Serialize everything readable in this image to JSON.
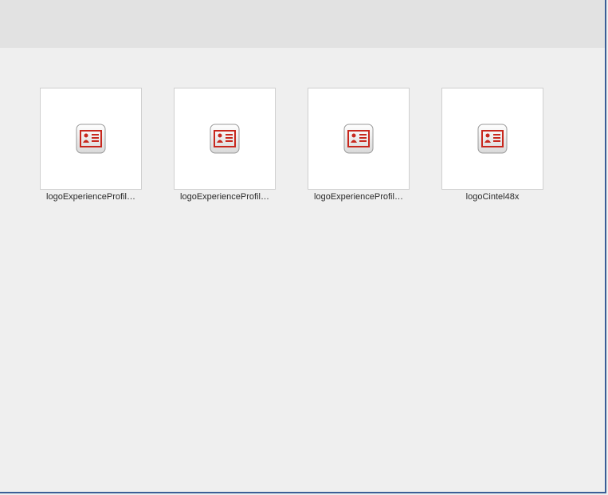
{
  "files": [
    {
      "name": "logoExperienceProfil…",
      "icon": "id-card-icon"
    },
    {
      "name": "logoExperienceProfil…",
      "icon": "id-card-icon"
    },
    {
      "name": "logoExperienceProfil…",
      "icon": "id-card-icon"
    },
    {
      "name": "logoCintel48x",
      "icon": "id-card-icon"
    }
  ],
  "colors": {
    "toolbar_bg": "#e2e2e2",
    "content_bg": "#efefef",
    "frame_border": "#3b5f97",
    "icon_red": "#c8281e"
  }
}
